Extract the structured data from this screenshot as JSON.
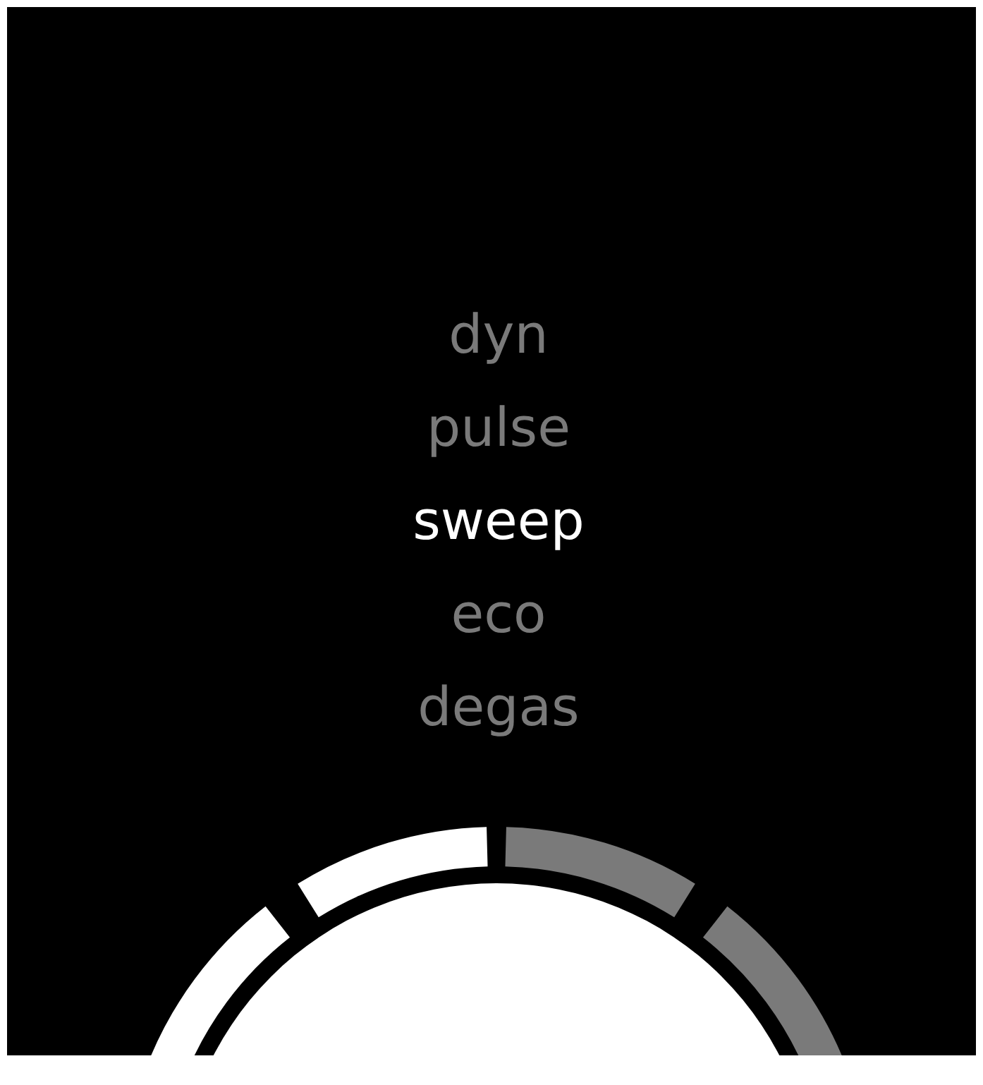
{
  "modes": [
    {
      "label": "dyn",
      "selected": false
    },
    {
      "label": "pulse",
      "selected": false
    },
    {
      "label": "sweep",
      "selected": true
    },
    {
      "label": "eco",
      "selected": false
    },
    {
      "label": "degas",
      "selected": false
    }
  ],
  "indicator": {
    "segments": [
      {
        "on": true
      },
      {
        "on": true
      },
      {
        "on": false
      },
      {
        "on": false
      }
    ]
  }
}
